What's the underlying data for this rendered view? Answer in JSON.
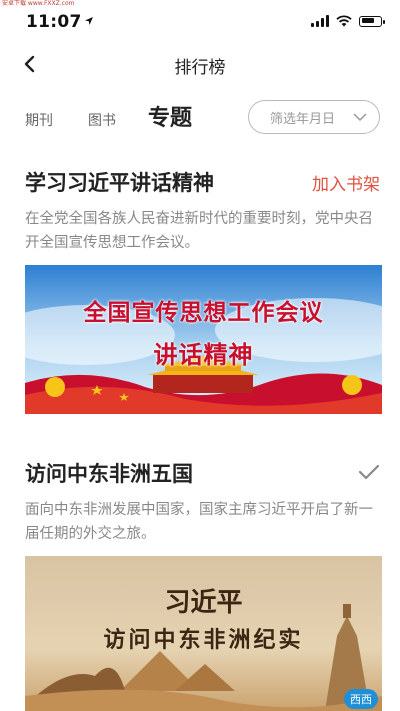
{
  "watermark": "安卓下载 www.FXXZ.com",
  "status": {
    "time": "11:07"
  },
  "nav": {
    "title": "排行榜"
  },
  "tabs": [
    {
      "label": "期刊"
    },
    {
      "label": "图书"
    },
    {
      "label": "专题"
    }
  ],
  "filter": {
    "label": "筛选年月日"
  },
  "sections": [
    {
      "title": "学习习近平讲话精神",
      "action": "加入书架",
      "desc": "在全党全国各族人民奋进新时代的重要时刻，党中央召开全国宣传思想工作会议。",
      "banner_line1": "全国宣传思想工作会议",
      "banner_line2": "讲话精神"
    },
    {
      "title": "访问中东非洲五国",
      "action_icon": "check-icon",
      "desc": "面向中东非洲发展中国家，国家主席习近平开启了新一届任期的外交之旅。",
      "banner_line1": "习近平",
      "banner_line2": "访问中东非洲纪实"
    }
  ],
  "corner_logo": "西西"
}
